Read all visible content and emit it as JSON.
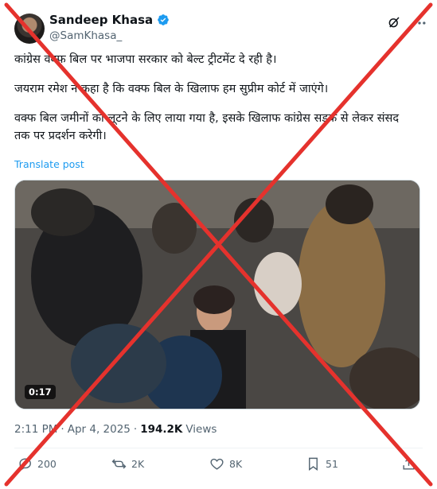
{
  "user": {
    "display_name": "Sandeep Khasa",
    "handle": "@SamKhasa_"
  },
  "tweet": {
    "paragraphs": [
      "कांग्रेस वक्फ बिल पर भाजपा सरकार को बेल्ट ट्रीटमेंट दे रही है।",
      "जयराम रमेश ने कहा है कि वक्फ बिल के खिलाफ हम सुप्रीम कोर्ट में जाएंगे।",
      "वक्फ बिल जमीनों को लूटने के लिए लाया गया है, इसके खिलाफ कांग्रेस सड़क से लेकर संसद तक पर प्रदर्शन करेगी।"
    ],
    "translate_label": "Translate post"
  },
  "media": {
    "duration": "0:17"
  },
  "meta": {
    "time": "2:11 PM",
    "separator": "·",
    "date": "Apr 4, 2025",
    "views_count": "194.2K",
    "views_label": "Views"
  },
  "actions": {
    "replies": "200",
    "reposts": "2K",
    "likes": "8K",
    "bookmarks": "51"
  },
  "icons": [
    "verified-badge-icon",
    "grok-icon",
    "more-icon",
    "reply-icon",
    "repost-icon",
    "like-icon",
    "bookmark-icon",
    "share-icon"
  ],
  "colors": {
    "accent": "#1d9bf0",
    "cross": "#e5322d"
  }
}
